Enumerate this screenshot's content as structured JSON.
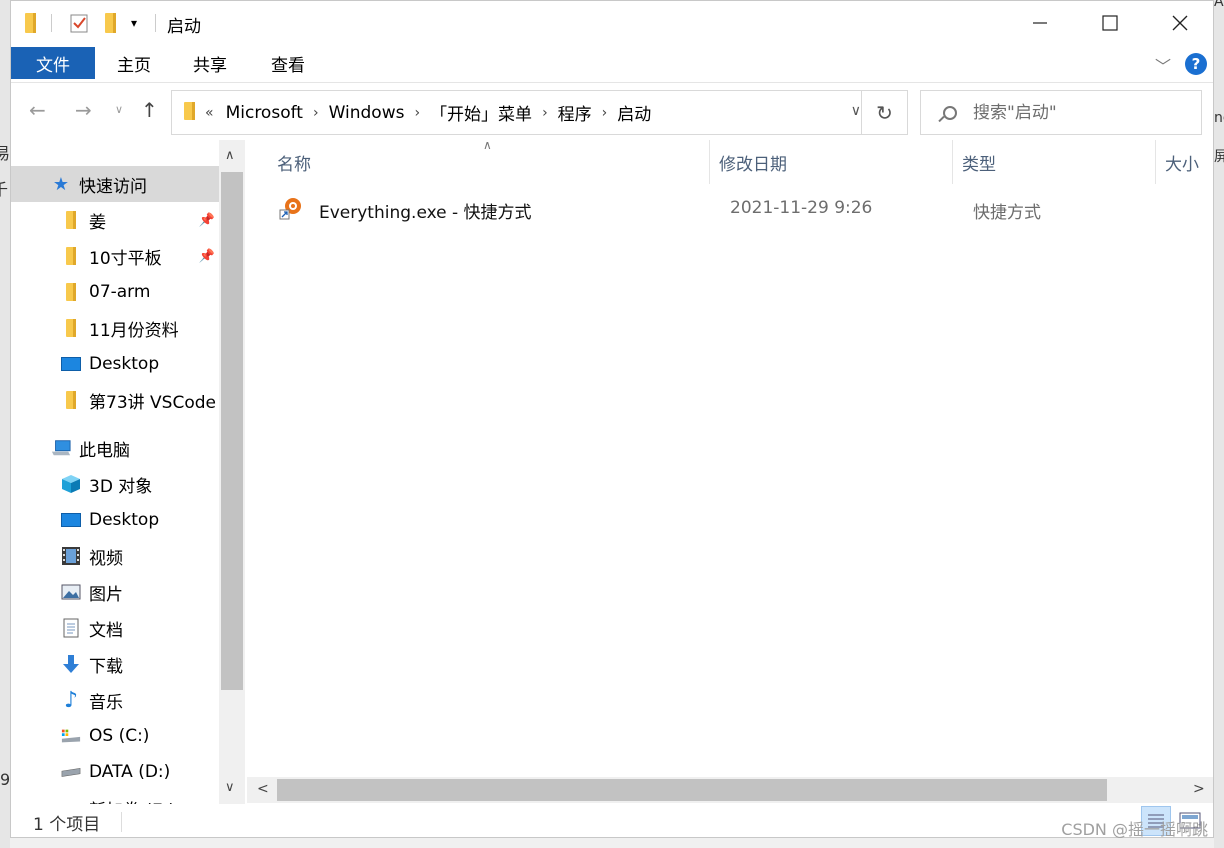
{
  "window": {
    "title": "启动"
  },
  "ribbon": {
    "tabs": [
      {
        "label": "文件",
        "active": true
      },
      {
        "label": "主页",
        "active": false
      },
      {
        "label": "共享",
        "active": false
      },
      {
        "label": "查看",
        "active": false
      }
    ],
    "help_label": "?"
  },
  "address": {
    "overflow": "«",
    "crumbs": [
      "Microsoft",
      "Windows",
      "「开始」菜单",
      "程序",
      "启动"
    ]
  },
  "search": {
    "placeholder": "搜索\"启动\""
  },
  "nav_pane": {
    "quick_access": {
      "label": "快速访问",
      "icon": "star-icon"
    },
    "quick_items": [
      {
        "label": "姜",
        "icon": "folder-icon",
        "pinned": true
      },
      {
        "label": "10寸平板",
        "icon": "folder-icon",
        "pinned": true
      },
      {
        "label": "07-arm",
        "icon": "folder-icon",
        "pinned": false
      },
      {
        "label": "11月份资料",
        "icon": "folder-icon",
        "pinned": false
      },
      {
        "label": "Desktop",
        "icon": "desktop-icon",
        "pinned": false
      },
      {
        "label": "第73讲 VSCode",
        "icon": "folder-icon",
        "pinned": false
      }
    ],
    "this_pc": {
      "label": "此电脑",
      "icon": "computer-icon"
    },
    "pc_items": [
      {
        "label": "3D 对象",
        "icon": "cube-icon"
      },
      {
        "label": "Desktop",
        "icon": "desktop-icon"
      },
      {
        "label": "视频",
        "icon": "video-icon"
      },
      {
        "label": "图片",
        "icon": "picture-icon"
      },
      {
        "label": "文档",
        "icon": "document-icon"
      },
      {
        "label": "下载",
        "icon": "download-icon"
      },
      {
        "label": "音乐",
        "icon": "music-icon"
      },
      {
        "label": "OS (C:)",
        "icon": "drive-c-icon"
      },
      {
        "label": "DATA (D:)",
        "icon": "drive-icon"
      },
      {
        "label": "新加卷 (E:)",
        "icon": "drive-icon"
      }
    ]
  },
  "columns": {
    "name": "名称",
    "modified": "修改日期",
    "type": "类型",
    "size": "大小"
  },
  "files": [
    {
      "name": "Everything.exe - 快捷方式",
      "modified": "2021-11-29 9:26",
      "type": "快捷方式",
      "icon": "shortcut-icon"
    }
  ],
  "status": {
    "count_text": "1 个项目"
  },
  "watermark": "CSDN @摇一摇啊跳",
  "background": {
    "left_chars": [
      "易",
      "千",
      "9"
    ],
    "right_chars": [
      "Ac",
      "ne",
      "屏"
    ]
  },
  "colors": {
    "accent": "#1a62b5",
    "selection": "#cce1f7",
    "folder": "#f8c94c"
  }
}
